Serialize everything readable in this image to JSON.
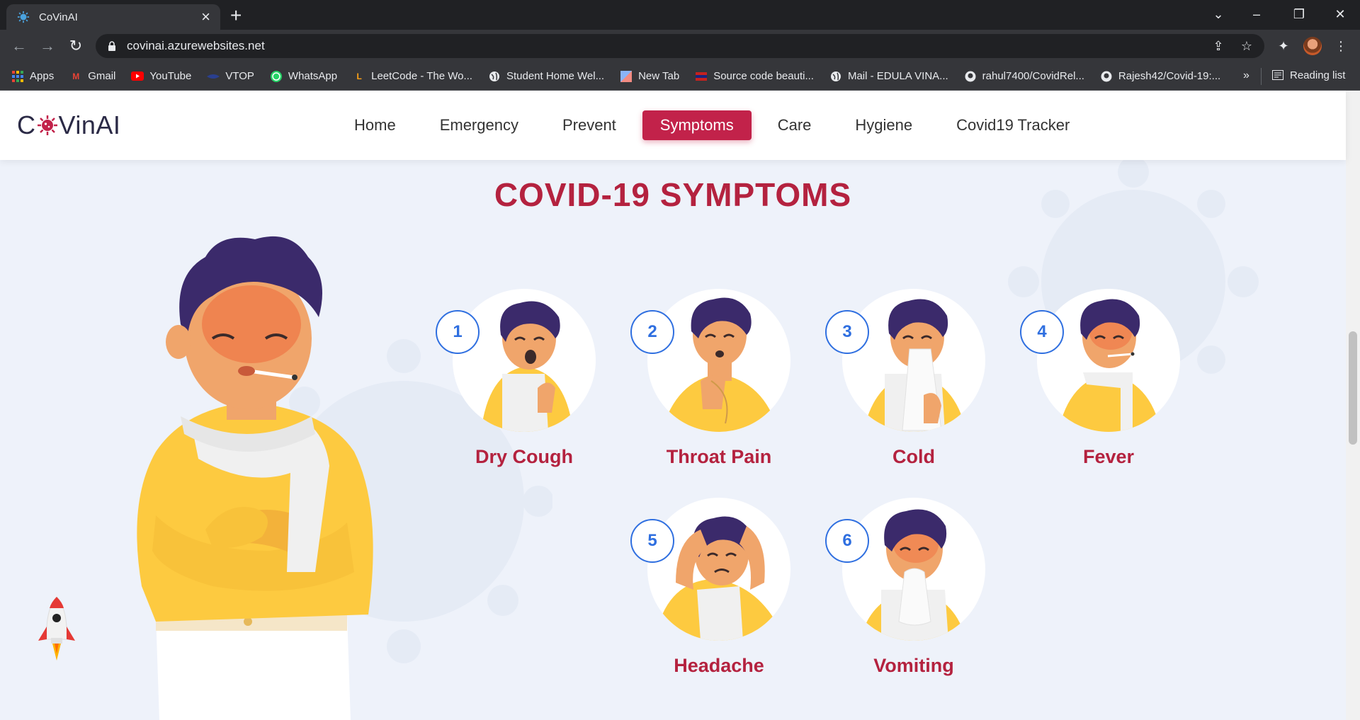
{
  "browser": {
    "tab_title": "CoVinAI",
    "url": "covinai.azurewebsites.net",
    "bookmarks": [
      {
        "label": "Apps",
        "icon": "apps-grid-icon"
      },
      {
        "label": "Gmail",
        "icon": "gmail-icon"
      },
      {
        "label": "YouTube",
        "icon": "youtube-icon"
      },
      {
        "label": "VTOP",
        "icon": "vtop-icon"
      },
      {
        "label": "WhatsApp",
        "icon": "whatsapp-icon"
      },
      {
        "label": "LeetCode - The Wo...",
        "icon": "leetcode-icon"
      },
      {
        "label": "Student Home Wel...",
        "icon": "globe-icon"
      },
      {
        "label": "New Tab",
        "icon": "newtab-icon"
      },
      {
        "label": "Source code beauti...",
        "icon": "source-code-icon"
      },
      {
        "label": "Mail - EDULA VINA...",
        "icon": "globe-icon"
      },
      {
        "label": "rahul7400/CovidRel...",
        "icon": "github-icon"
      },
      {
        "label": "Rajesh42/Covid-19:...",
        "icon": "github-icon"
      }
    ],
    "more_bookmarks": "»",
    "reading_list": "Reading list"
  },
  "site": {
    "logo_prefix": "C",
    "logo_suffix": "VinAI",
    "nav": [
      "Home",
      "Emergency",
      "Prevent",
      "Symptoms",
      "Care",
      "Hygiene",
      "Covid19 Tracker"
    ],
    "active_nav": "Symptoms",
    "accent_color": "#c2224a"
  },
  "section": {
    "title": "COVID-19 SYMPTOMS",
    "symptoms": [
      {
        "num": "1",
        "label": "Dry Cough"
      },
      {
        "num": "2",
        "label": "Throat Pain"
      },
      {
        "num": "3",
        "label": "Cold"
      },
      {
        "num": "4",
        "label": "Fever"
      },
      {
        "num": "5",
        "label": "Headache"
      },
      {
        "num": "6",
        "label": "Vomiting"
      }
    ]
  }
}
